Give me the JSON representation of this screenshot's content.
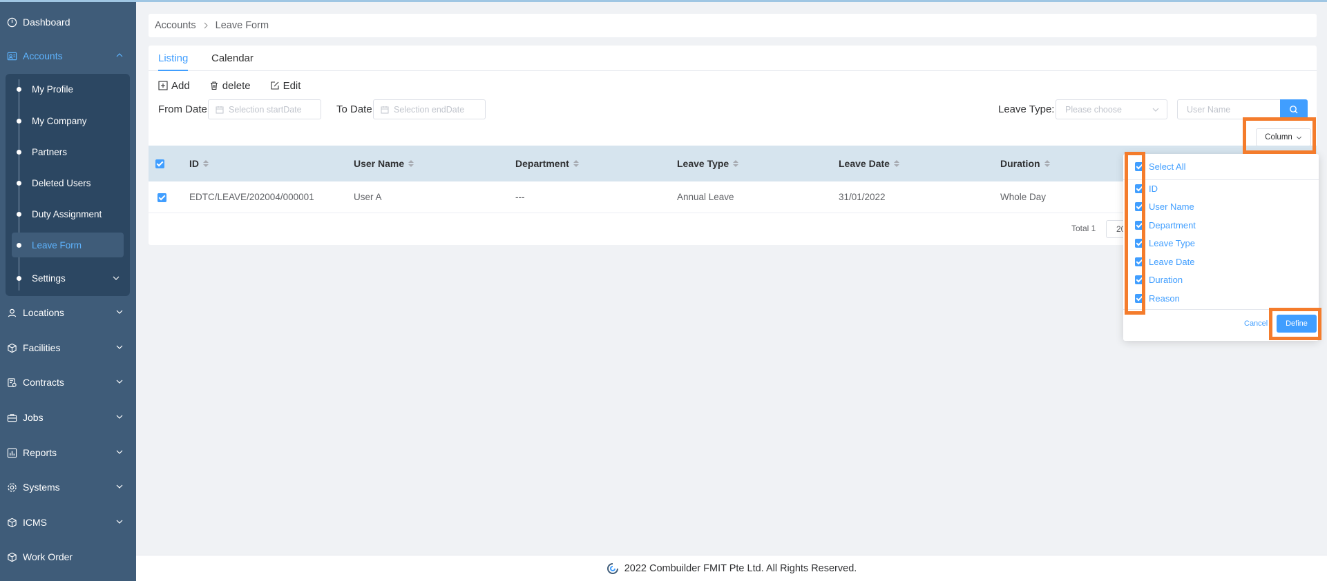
{
  "sidebar": {
    "items": [
      {
        "label": "Dashboard"
      },
      {
        "label": "Accounts"
      },
      {
        "label": "Locations"
      },
      {
        "label": "Facilities"
      },
      {
        "label": "Contracts"
      },
      {
        "label": "Jobs"
      },
      {
        "label": "Reports"
      },
      {
        "label": "Systems"
      },
      {
        "label": "ICMS"
      },
      {
        "label": "Work Order"
      }
    ],
    "accounts_sub": [
      {
        "label": "My Profile"
      },
      {
        "label": "My Company"
      },
      {
        "label": "Partners"
      },
      {
        "label": "Deleted Users"
      },
      {
        "label": "Duty Assignment"
      },
      {
        "label": "Leave Form"
      },
      {
        "label": "Settings"
      }
    ]
  },
  "breadcrumb": {
    "parent": "Accounts",
    "current": "Leave Form"
  },
  "tabs": [
    {
      "label": "Listing"
    },
    {
      "label": "Calendar"
    }
  ],
  "toolbar": {
    "add": "Add",
    "delete": "delete",
    "edit": "Edit"
  },
  "filters": {
    "from_label": "From Date",
    "from_placeholder": "Selection startDate",
    "to_label": "To Date",
    "to_placeholder": "Selection endDate",
    "leave_type_label": "Leave Type:",
    "leave_type_placeholder": "Please choose",
    "user_placeholder": "User Name"
  },
  "column_button": "Column",
  "table": {
    "headers": [
      "ID",
      "User Name",
      "Department",
      "Leave Type",
      "Leave Date",
      "Duration"
    ],
    "rows": [
      [
        "EDTC/LEAVE/202004/000001",
        "User A",
        "---",
        "Annual Leave",
        "31/01/2022",
        "Whole Day"
      ]
    ],
    "total": "Total 1",
    "page_size": "20"
  },
  "column_dropdown": {
    "select_all": "Select All",
    "options": [
      "ID",
      "User Name",
      "Department",
      "Leave Type",
      "Leave Date",
      "Duration",
      "Reason"
    ],
    "cancel": "Cancel",
    "define": "Define"
  },
  "footer": {
    "text": "2022 Combuilder FMIT Pte Ltd. All Rights Reserved."
  },
  "colors": {
    "accent": "#409eff",
    "sidebar": "#3f5c79",
    "submenu": "#2c4762",
    "highlight": "#f47c2c"
  }
}
